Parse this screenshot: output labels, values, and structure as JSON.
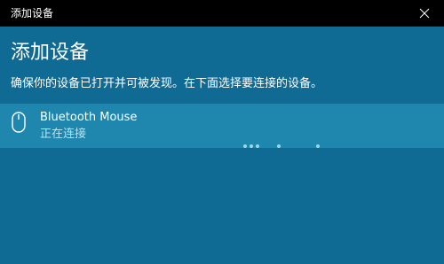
{
  "window": {
    "title": "添加设备",
    "close_icon": "close-icon"
  },
  "main": {
    "heading": "添加设备",
    "instruction": "确保你的设备已打开并可被发现。在下面选择要连接的设备。"
  },
  "devices": [
    {
      "icon": "mouse-icon",
      "name": "Bluetooth Mouse",
      "status": "正在连接"
    }
  ],
  "colors": {
    "background": "#0f6a94",
    "titlebar": "#000000",
    "selected_row": "#1f86ad",
    "status_text": "#b9e2f2",
    "progress_dot": "#9fd6ea"
  }
}
